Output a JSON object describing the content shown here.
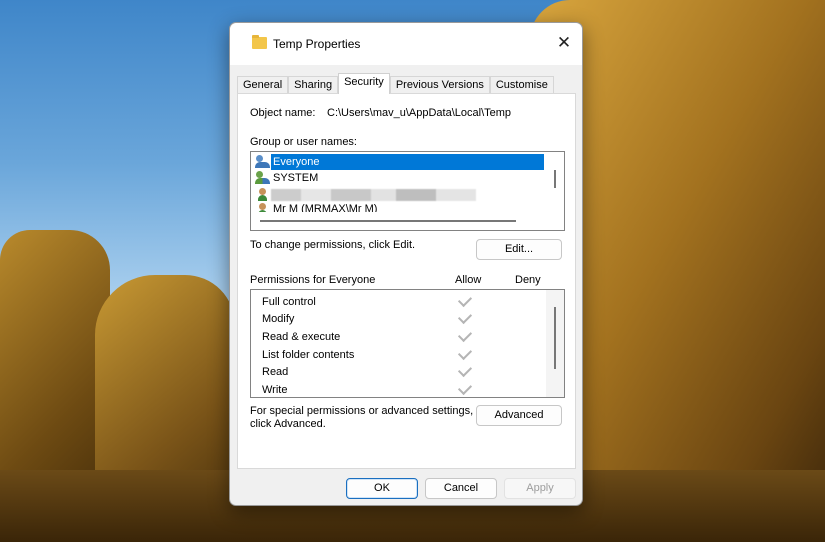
{
  "dialog": {
    "title": "Temp Properties",
    "close": "✕"
  },
  "tabs": [
    "General",
    "Sharing",
    "Security",
    "Previous Versions",
    "Customise"
  ],
  "active_tab": "Security",
  "object_name": {
    "label": "Object name:",
    "value": "C:\\Users\\mav_u\\AppData\\Local\\Temp"
  },
  "groups": {
    "label": "Group or user names:",
    "items": [
      {
        "name": "Everyone",
        "selected": true
      },
      {
        "name": "SYSTEM"
      },
      {
        "name": ""
      },
      {
        "name": "Mr M (MRMAX\\Mr M)"
      }
    ]
  },
  "change_text": "To change permissions, click Edit.",
  "edit_button": "Edit...",
  "permissions": {
    "label": "Permissions for Everyone",
    "allow": "Allow",
    "deny": "Deny",
    "rows": [
      {
        "name": "Full control",
        "allow": true,
        "deny": false
      },
      {
        "name": "Modify",
        "allow": true,
        "deny": false
      },
      {
        "name": "Read & execute",
        "allow": true,
        "deny": false
      },
      {
        "name": "List folder contents",
        "allow": true,
        "deny": false
      },
      {
        "name": "Read",
        "allow": true,
        "deny": false
      },
      {
        "name": "Write",
        "allow": true,
        "deny": false
      }
    ]
  },
  "advanced_text_1": "For special permissions or advanced settings,",
  "advanced_text_2": "click Advanced.",
  "advanced_button": "Advanced",
  "footer": {
    "ok": "OK",
    "cancel": "Cancel",
    "apply": "Apply"
  }
}
